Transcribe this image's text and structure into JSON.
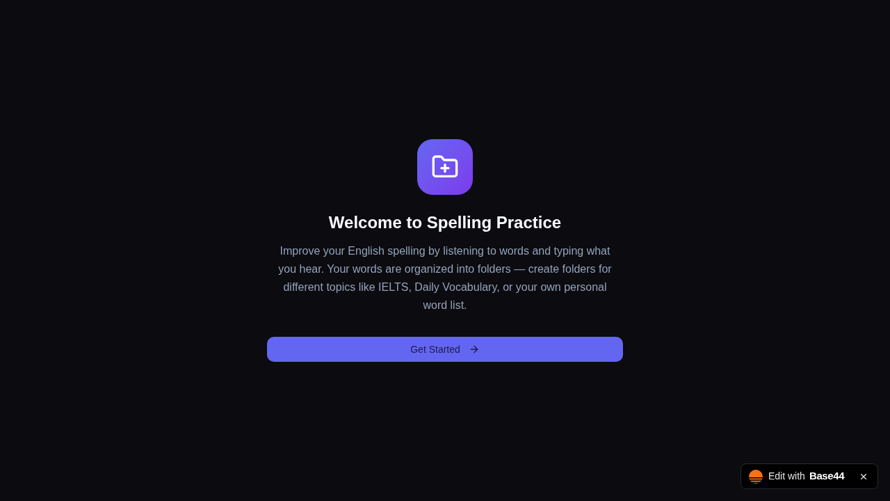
{
  "welcome": {
    "title": "Welcome to Spelling Practice",
    "description": "Improve your English spelling by listening to words and typing what you hear. Your words are organized into folders — create folders for different topics like IELTS, Daily Vocabulary, or your own personal word list.",
    "button": {
      "label": "Get Started"
    }
  },
  "edit_badge": {
    "label": "Edit with",
    "brand": "Base44"
  }
}
